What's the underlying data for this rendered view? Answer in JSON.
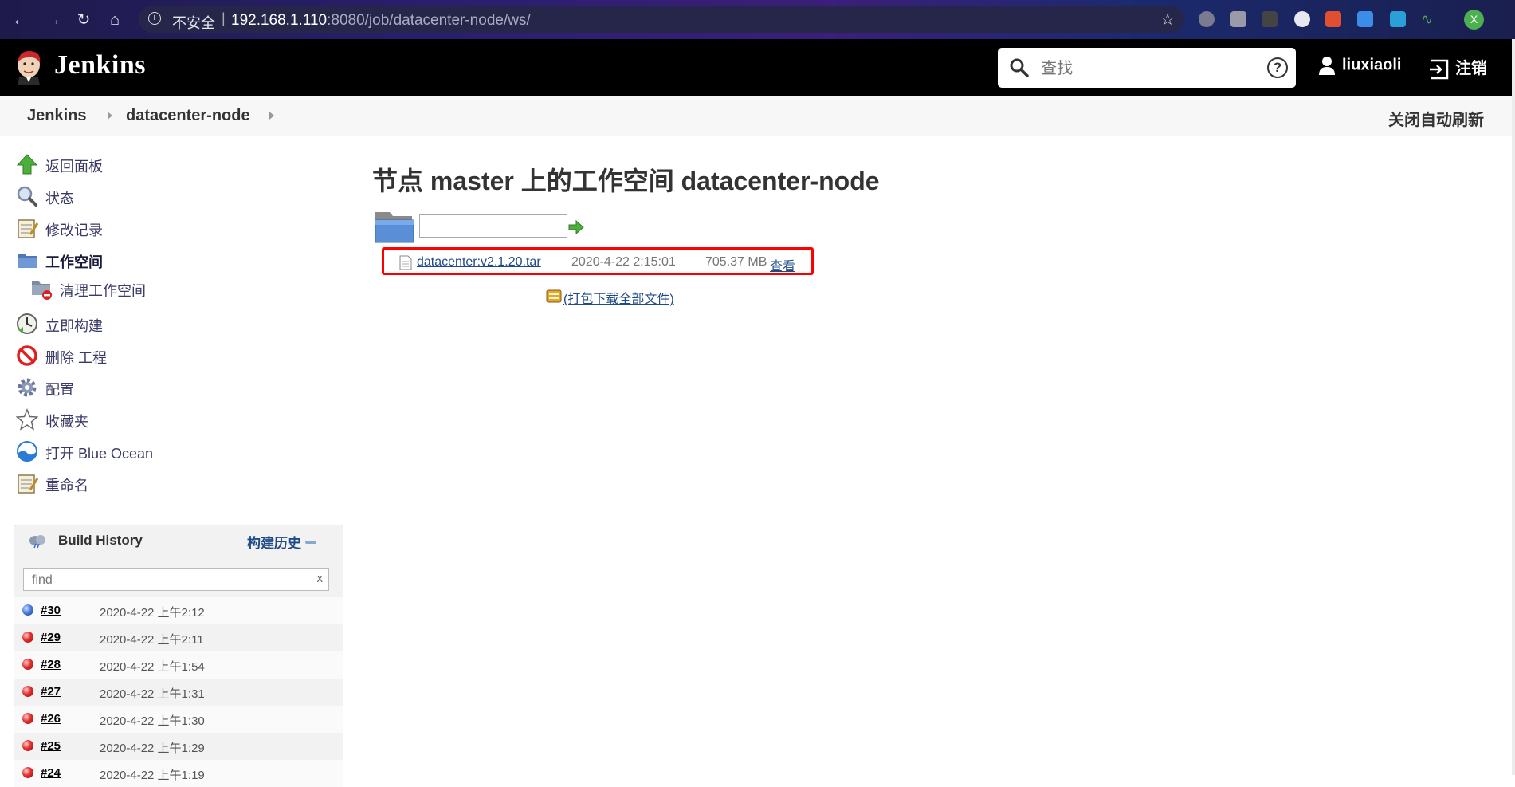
{
  "browser": {
    "security_label": "不安全",
    "url_host": "192.168.1.110",
    "url_path": ":8080/job/datacenter-node/ws/",
    "profile_initial": "X"
  },
  "header": {
    "brand": "Jenkins",
    "search_placeholder": "查找",
    "username": "liuxiaoli",
    "logout_label": "注销"
  },
  "breadcrumb": {
    "items": [
      "Jenkins",
      "datacenter-node"
    ],
    "auto_refresh": "关闭自动刷新"
  },
  "sidebar": {
    "items": [
      {
        "label": "返回面板",
        "icon": "up-arrow-icon"
      },
      {
        "label": "状态",
        "icon": "magnifier-icon"
      },
      {
        "label": "修改记录",
        "icon": "notepad-icon"
      },
      {
        "label": "工作空间",
        "icon": "folder-icon"
      },
      {
        "label": "清理工作空间",
        "icon": "folder-delete-icon"
      },
      {
        "label": "立即构建",
        "icon": "clock-icon"
      },
      {
        "label": "删除 工程",
        "icon": "no-entry-icon"
      },
      {
        "label": "配置",
        "icon": "gear-icon"
      },
      {
        "label": "收藏夹",
        "icon": "star-icon"
      },
      {
        "label": "打开 Blue Ocean",
        "icon": "blue-ocean-icon"
      },
      {
        "label": "重命名",
        "icon": "notepad-icon"
      }
    ]
  },
  "build_history": {
    "title": "Build History",
    "trend_label": "构建历史",
    "find_placeholder": "find",
    "clear_label": "x",
    "builds": [
      {
        "num": "#30",
        "time": "2020-4-22 上午2:12",
        "status": "blue"
      },
      {
        "num": "#29",
        "time": "2020-4-22 上午2:11",
        "status": "red"
      },
      {
        "num": "#28",
        "time": "2020-4-22 上午1:54",
        "status": "red"
      },
      {
        "num": "#27",
        "time": "2020-4-22 上午1:31",
        "status": "red"
      },
      {
        "num": "#26",
        "time": "2020-4-22 上午1:30",
        "status": "red"
      },
      {
        "num": "#25",
        "time": "2020-4-22 上午1:29",
        "status": "red"
      },
      {
        "num": "#24",
        "time": "2020-4-22 上午1:19",
        "status": "red"
      }
    ]
  },
  "main": {
    "title": "节点 master 上的工作空间 datacenter-node",
    "path_input_value": "",
    "files": [
      {
        "name": "datacenter:v2.1.20.tar",
        "date": "2020-4-22 2:15:01",
        "size": "705.37 MB",
        "view_label": "查看"
      }
    ],
    "download_all": "(打包下载全部文件)"
  },
  "colors": {
    "highlight": "#ff0000",
    "link": "#204a87",
    "header_bg": "#000000"
  }
}
